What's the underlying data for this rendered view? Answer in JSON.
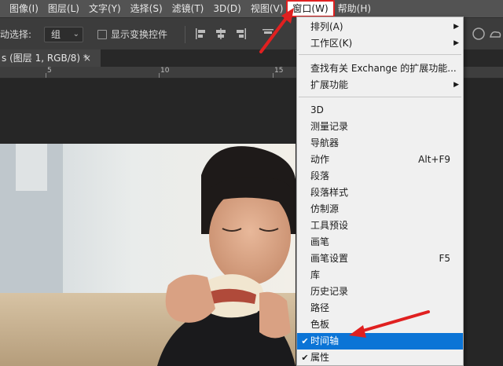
{
  "menubar": {
    "items": [
      {
        "label": "图像(I)"
      },
      {
        "label": "图层(L)"
      },
      {
        "label": "文字(Y)"
      },
      {
        "label": "选择(S)"
      },
      {
        "label": "滤镜(T)"
      },
      {
        "label": "3D(D)"
      },
      {
        "label": "视图(V)"
      },
      {
        "label": "窗口(W)"
      },
      {
        "label": "帮助(H)"
      }
    ]
  },
  "options": {
    "auto_select_label": "动选择:",
    "auto_select_value": "组",
    "show_transform_label": "显示变换控件"
  },
  "document": {
    "tab_title": "s (图层 1, RGB/8) *",
    "close_glyph": "×"
  },
  "ruler": {
    "labels": [
      "5",
      "10",
      "15"
    ]
  },
  "window_menu": {
    "items": [
      {
        "label": "排列(A)",
        "submenu": true
      },
      {
        "label": "工作区(K)",
        "submenu": true
      },
      {
        "label": "查找有关 Exchange 的扩展功能..."
      },
      {
        "label": "扩展功能",
        "submenu": true
      },
      {
        "label": "3D"
      },
      {
        "label": "测量记录"
      },
      {
        "label": "导航器"
      },
      {
        "label": "动作",
        "shortcut": "Alt+F9"
      },
      {
        "label": "段落"
      },
      {
        "label": "段落样式"
      },
      {
        "label": "仿制源"
      },
      {
        "label": "工具预设"
      },
      {
        "label": "画笔"
      },
      {
        "label": "画笔设置",
        "shortcut": "F5"
      },
      {
        "label": "库"
      },
      {
        "label": "历史记录"
      },
      {
        "label": "路径"
      },
      {
        "label": "色板"
      },
      {
        "label": "时间轴",
        "checked": true,
        "highlighted": true
      },
      {
        "label": "属性",
        "checked": true
      }
    ]
  },
  "colors": {
    "highlight": "#0b74d6",
    "annotation_red": "#e02020"
  }
}
